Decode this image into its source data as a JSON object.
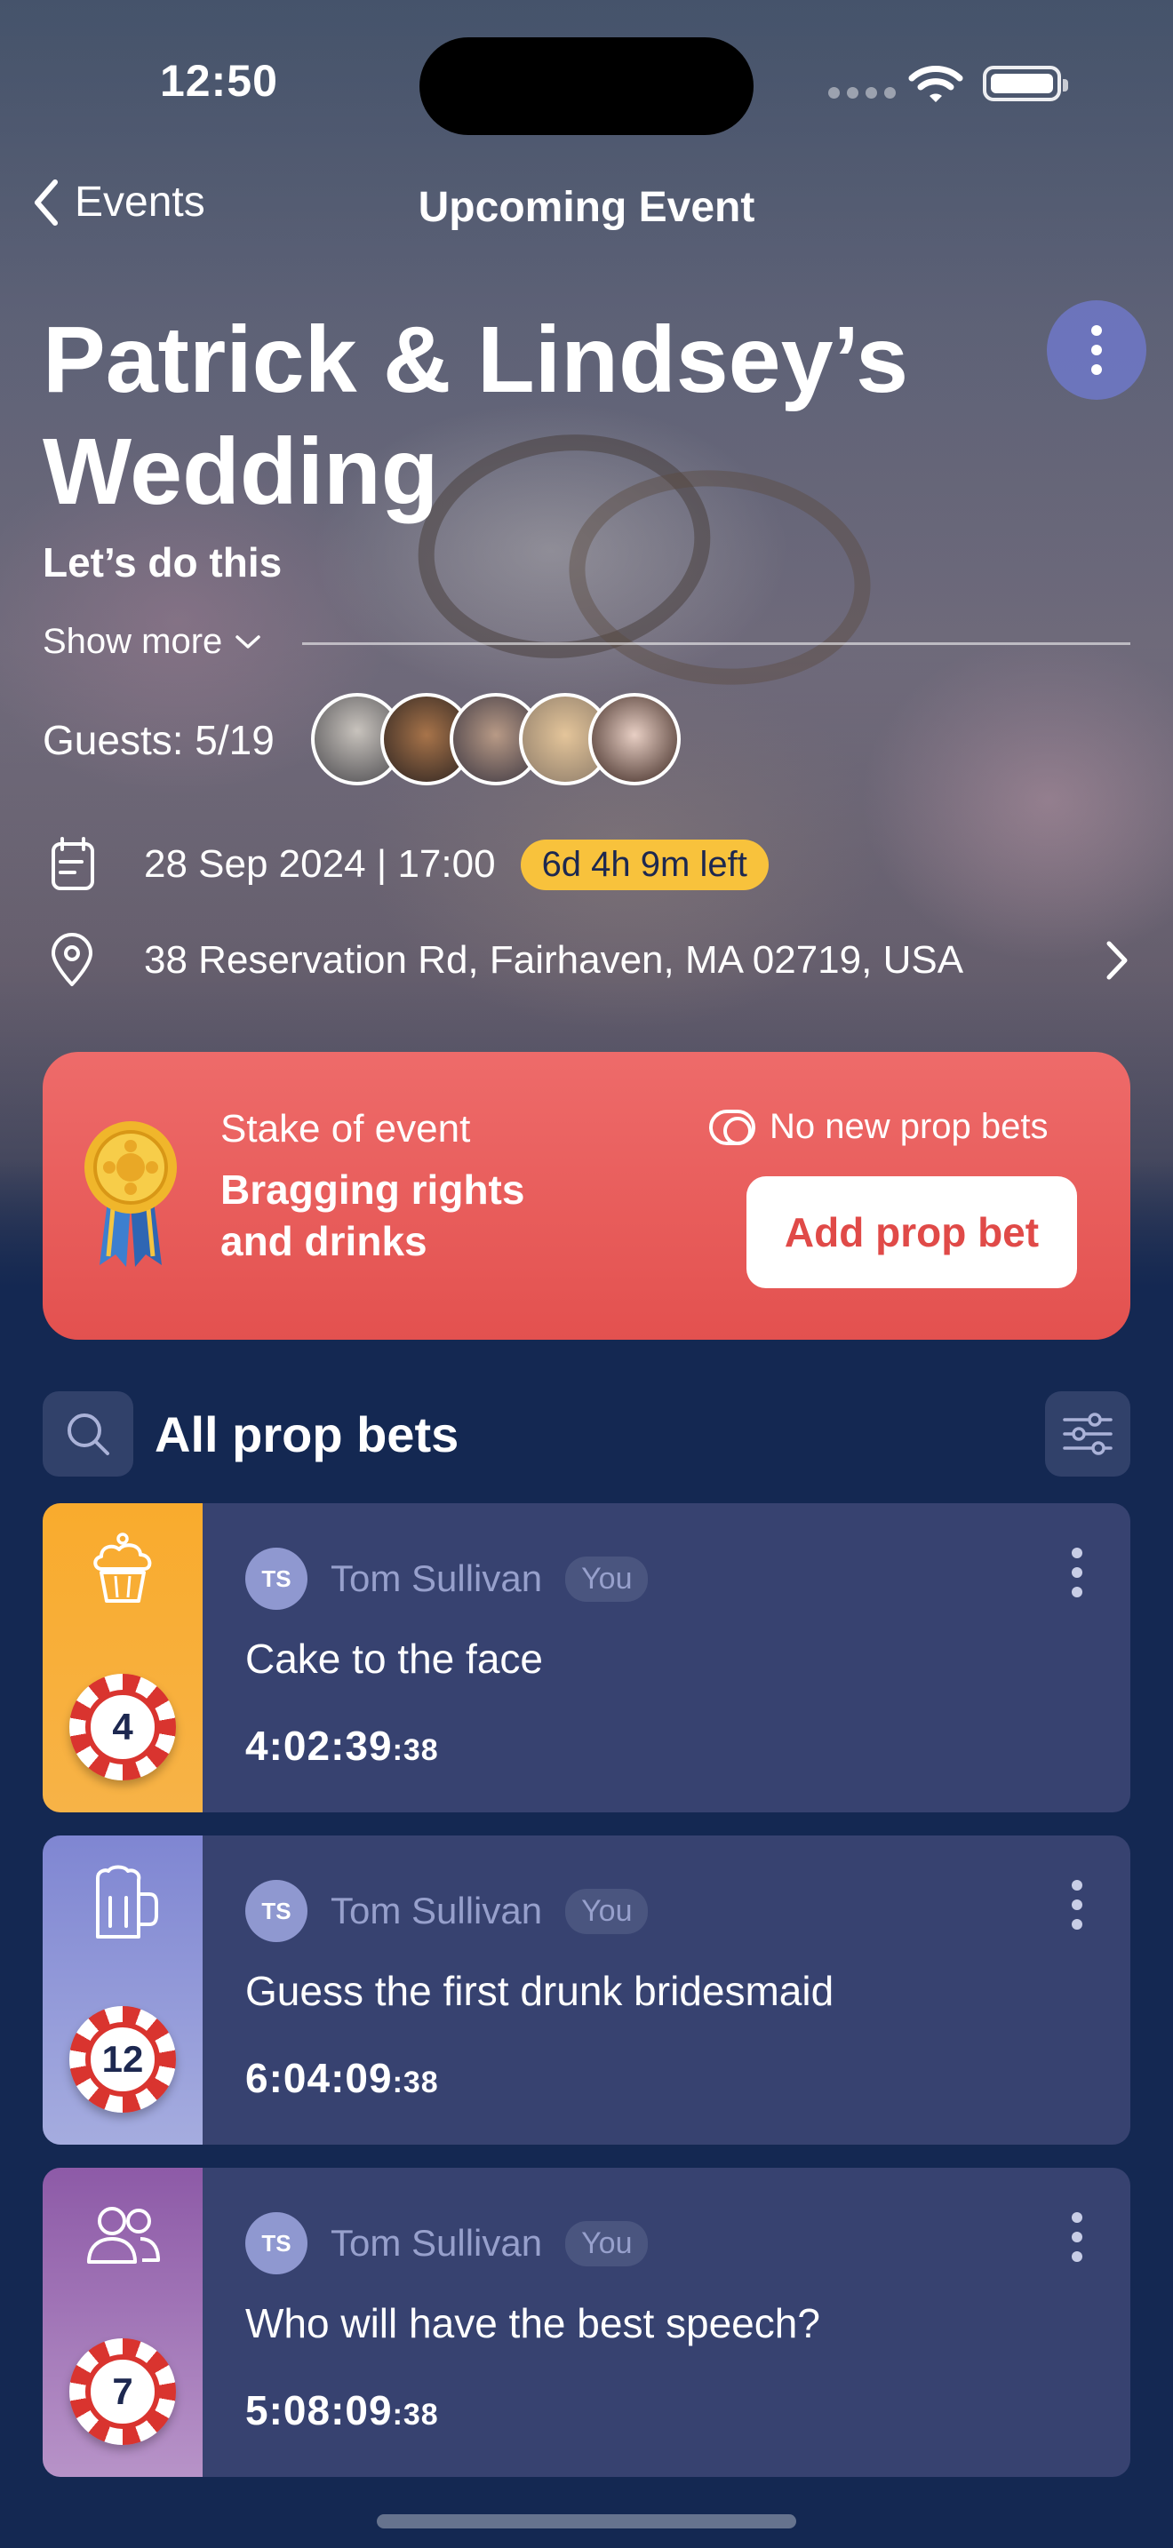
{
  "status_bar": {
    "time": "12:50"
  },
  "nav": {
    "back_label": "Events",
    "title": "Upcoming Event"
  },
  "event": {
    "title": "Patrick & Lindsey’s Wedding",
    "subtitle": "Let’s do this",
    "show_more": "Show more",
    "guests_label": "Guests: 5/19",
    "date_time": "28 Sep 2024 | 17:00",
    "countdown": "6d 4h 9m left",
    "location": "38 Reservation Rd, Fairhaven, MA 02719, USA"
  },
  "stake": {
    "label": "Stake of event",
    "value": "Bragging rights and drinks",
    "toggle_label": "No new prop bets",
    "add_button": "Add prop bet"
  },
  "bets_section": {
    "title": "All prop bets"
  },
  "bets": [
    {
      "icon": "cupcake-icon",
      "accent": "#f8a52c",
      "count": "4",
      "initials": "TS",
      "author": "Tom Sullivan",
      "badge": "You",
      "title": "Cake to the face",
      "timer": "4:02:39",
      "timer_ms": ":38"
    },
    {
      "icon": "beer-mug-icon",
      "accent": "#8b8fd6",
      "count": "12",
      "initials": "TS",
      "author": "Tom Sullivan",
      "badge": "You",
      "title": "Guess the first drunk bridesmaid",
      "timer": "6:04:09",
      "timer_ms": ":38"
    },
    {
      "icon": "people-icon",
      "accent": "#9a63ae",
      "count": "7",
      "initials": "TS",
      "author": "Tom Sullivan",
      "badge": "You",
      "title": "Who will have the best speech?",
      "timer": "5:08:09",
      "timer_ms": ":38"
    }
  ],
  "colors": {
    "background": "#142852",
    "card": "#374270",
    "stake_red": "#e85c5a",
    "countdown_yellow": "#f8c23c",
    "more_button": "#6e78c8"
  }
}
